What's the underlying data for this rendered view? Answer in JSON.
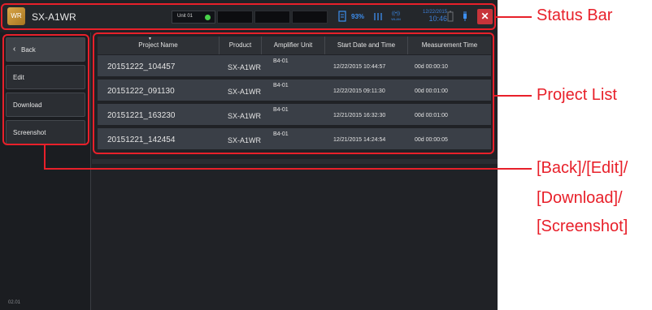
{
  "status_bar": {
    "logo_text": "WR",
    "model": "SX-A1WR",
    "unit_label": "Unit 01",
    "battery_percent": "93%",
    "date": "12/22/2015",
    "time": "10:46",
    "wlan_label": "WLAN",
    "close_symbol": "✕"
  },
  "sidebar": {
    "back_label": "Back",
    "edit_label": "Edit",
    "download_label": "Download",
    "screenshot_label": "Screenshot",
    "version": "02.01"
  },
  "table": {
    "columns": [
      "Project Name",
      "Product",
      "Amplifier Unit",
      "Start Date and Time",
      "Measurement Time"
    ],
    "rows": [
      {
        "project": "20151222_104457",
        "product": "SX-A1WR",
        "amp": "B4-01",
        "start": "12/22/2015 10:44:57",
        "measure": "00d 00:00:10"
      },
      {
        "project": "20151222_091130",
        "product": "SX-A1WR",
        "amp": "B4-01",
        "start": "12/22/2015 09:11:30",
        "measure": "00d 00:01:00"
      },
      {
        "project": "20151221_163230",
        "product": "SX-A1WR",
        "amp": "B4-01",
        "start": "12/21/2015 16:32:30",
        "measure": "00d 00:01:00"
      },
      {
        "project": "20151221_142454",
        "product": "SX-A1WR",
        "amp": "B4-01",
        "start": "12/21/2015 14:24:54",
        "measure": "00d 00:00:05"
      }
    ]
  },
  "annotations": {
    "status_bar": "Status Bar",
    "project_list": "Project List",
    "buttons_line1": "[Back]/[Edit]/",
    "buttons_line2": "[Download]/",
    "buttons_line3": "[Screenshot]"
  },
  "colors": {
    "accent_red": "#e8202a",
    "status_blue": "#3d8ff0",
    "close_red": "#c7343a"
  }
}
